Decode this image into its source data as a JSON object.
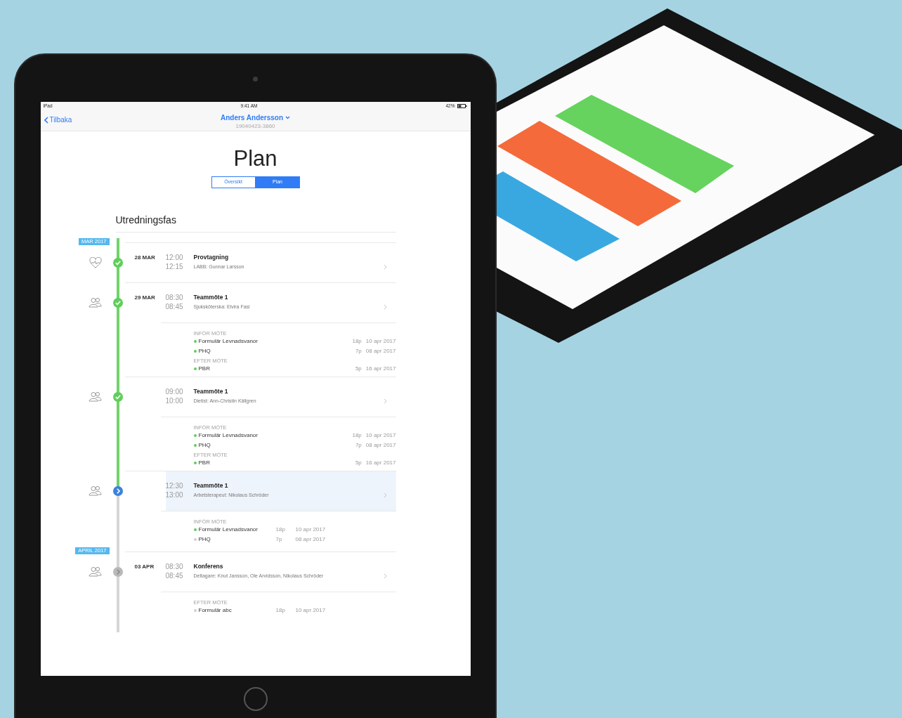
{
  "status_bar": {
    "carrier": "iPad",
    "time": "9:41 AM",
    "battery": "42%"
  },
  "nav": {
    "back": "Tilbaka",
    "title": "Anders Andersson",
    "subtitle": "19040423-3860"
  },
  "heading": "Plan",
  "segments": [
    {
      "label": "Översikt",
      "selected": false
    },
    {
      "label": "Plan",
      "selected": true
    }
  ],
  "section": "Utredningsfas",
  "timeline": [
    {
      "kind": "month",
      "label": "MAR 2017",
      "line_done": true
    },
    {
      "kind": "lab_event",
      "done": true,
      "current": false,
      "date": "28 MAR",
      "start": "12:00",
      "end": "12:15",
      "title": "Provtagning",
      "subtitle": "LABB: Gunnar Larsson",
      "selected": false
    },
    {
      "kind": "meeting_event",
      "done": true,
      "current": false,
      "date": "29 MAR",
      "start": "08:30",
      "end": "08:45",
      "title": "Teammöte 1",
      "subtitle": "Sjuksköterska: Elvira Fasi",
      "selected": false
    },
    {
      "kind": "tasks_wide",
      "line_done": true,
      "groups": [
        {
          "heading": "INFÖR MÖTE",
          "items": [
            {
              "name": "Formulär Levnadsvanor",
              "done": true,
              "count": "18p",
              "date": "10 apr 2017"
            },
            {
              "name": "PHQ",
              "done": true,
              "count": "7p",
              "date": "08 apr 2017"
            }
          ]
        },
        {
          "heading": "EFTER MÖTE",
          "items": [
            {
              "name": "PBR",
              "done": true,
              "count": "5p",
              "date": "16 apr 2017"
            }
          ]
        }
      ]
    },
    {
      "kind": "meeting_event",
      "done": true,
      "current": false,
      "start": "09:00",
      "end": "10:00",
      "title": "Teammöte 1",
      "subtitle": "Dietist: Ann-Christin Källgren",
      "selected": false
    },
    {
      "kind": "tasks_wide",
      "line_done": true,
      "groups": [
        {
          "heading": "INFÖR MÖTE",
          "items": [
            {
              "name": "Formulär Levnadsvanor",
              "done": true,
              "count": "18p",
              "date": "10 apr 2017"
            },
            {
              "name": "PHQ",
              "done": true,
              "count": "7p",
              "date": "08 apr 2017"
            }
          ]
        },
        {
          "heading": "EFTER MÖTE",
          "items": [
            {
              "name": "PBR",
              "done": true,
              "count": "5p",
              "date": "16 apr 2017"
            }
          ]
        }
      ]
    },
    {
      "kind": "meeting_event",
      "done": false,
      "current": true,
      "start": "12:30",
      "end": "13:00",
      "title": "Teammöte 1",
      "subtitle": "Arbetsterapeut: Nikolaus Schröder",
      "selected": true
    },
    {
      "kind": "tasks_compact",
      "line_done": false,
      "groups": [
        {
          "heading": "INFÖR MÖTE",
          "items": [
            {
              "name": "Formulär Levnadsvanor",
              "done": true,
              "count": "18p",
              "date": "10 apr 2017"
            },
            {
              "name": "PHQ",
              "done": false,
              "count": "7p",
              "date": "08 apr 2017"
            }
          ]
        }
      ]
    },
    {
      "kind": "month",
      "label": "APRIL 2017",
      "line_done": false
    },
    {
      "kind": "meeting_event",
      "done": false,
      "current": false,
      "date": "03 APR",
      "start": "08:30",
      "end": "08:45",
      "title": "Konferens",
      "subtitle": "Deltagare: Knut Jansson, Ole Arvidsson, Nikolaus Schröder",
      "selected": false
    },
    {
      "kind": "tasks_compact",
      "line_done": false,
      "groups": [
        {
          "heading": "EFTER MÖTE",
          "items": [
            {
              "name": "Formulär abc",
              "done": false,
              "count": "18p",
              "date": "10 apr 2017"
            }
          ]
        }
      ]
    }
  ]
}
